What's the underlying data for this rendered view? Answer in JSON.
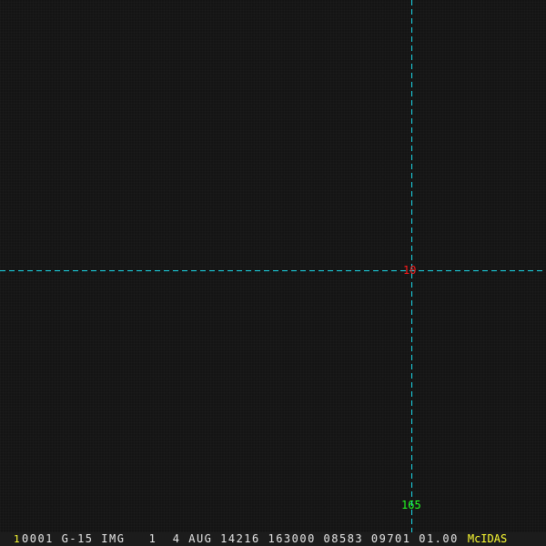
{
  "crosshair": {
    "center_label": "10",
    "bottom_label": "165"
  },
  "status_bar": {
    "frame_number": "1",
    "info": "0001 G-15 IMG   1  4 AUG 14216 163000 08583 09701 01.00",
    "brand": "McIDAS"
  },
  "colors": {
    "crosshair": "#1ad6e6",
    "center_label": "#ff1a1a",
    "bottom_label": "#22ff22",
    "brand": "#ffff33"
  }
}
